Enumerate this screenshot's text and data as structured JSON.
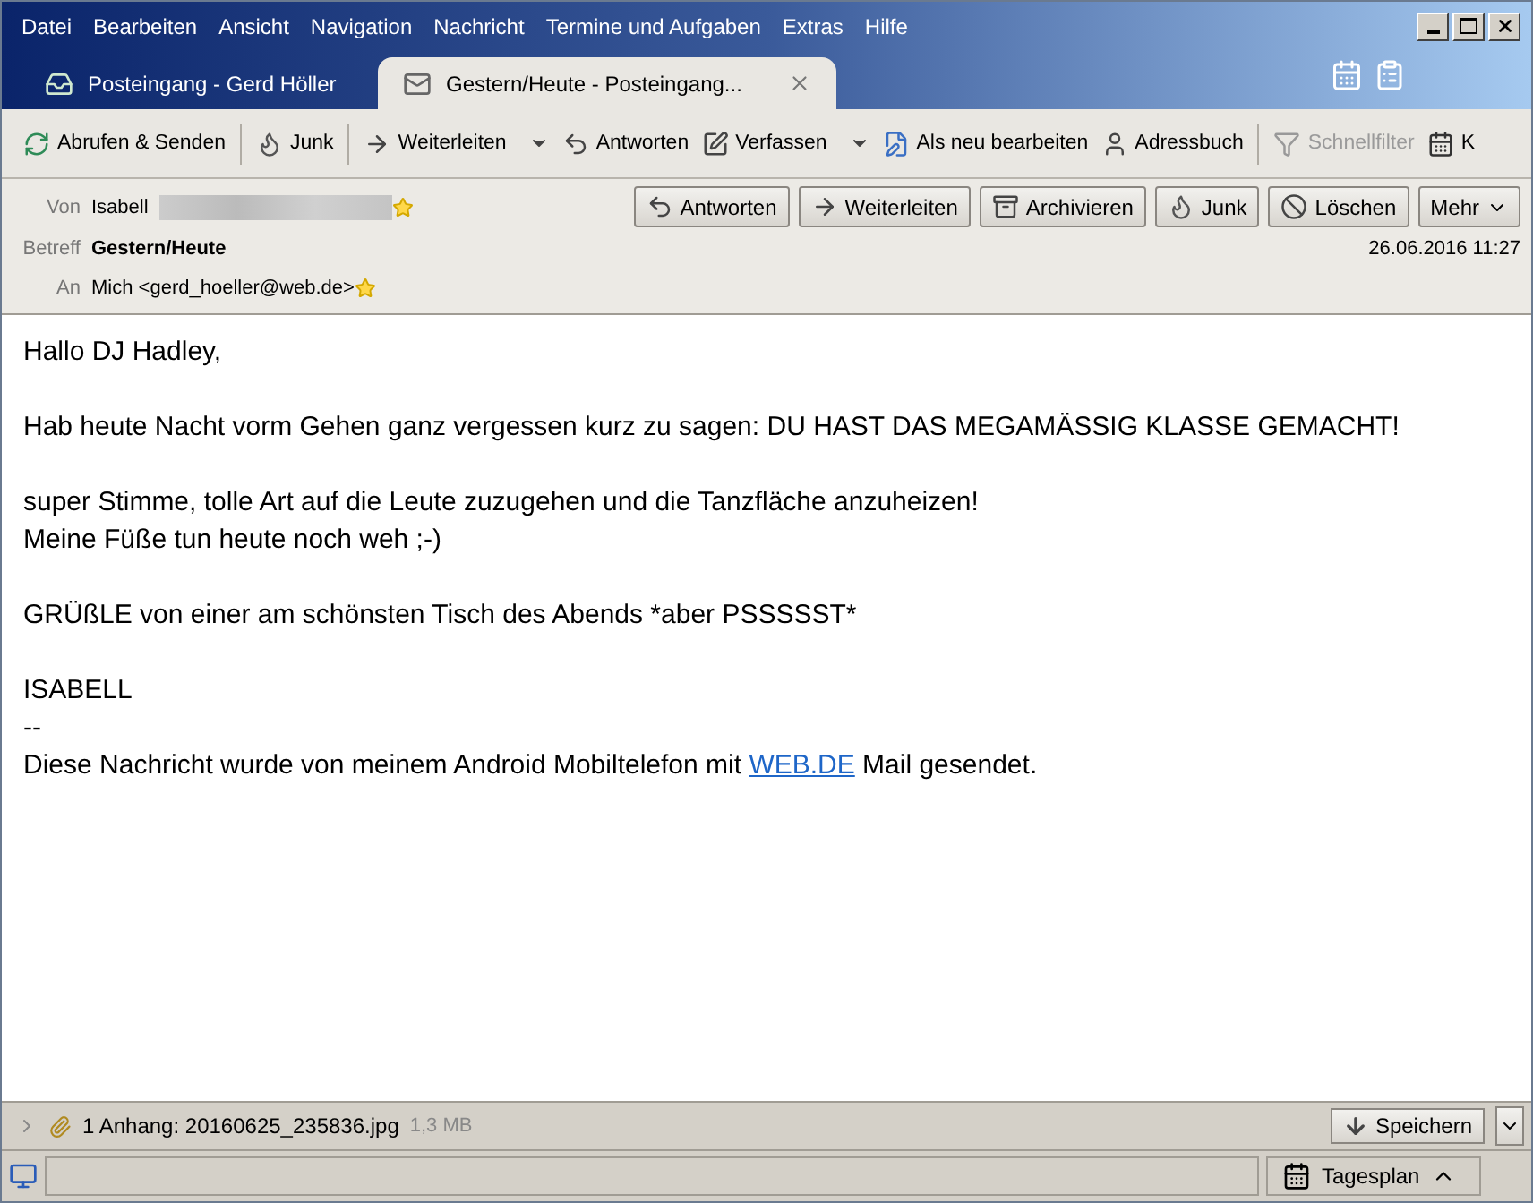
{
  "menu": [
    "Datei",
    "Bearbeiten",
    "Ansicht",
    "Navigation",
    "Nachricht",
    "Termine und Aufgaben",
    "Extras",
    "Hilfe"
  ],
  "tabs": [
    {
      "label": "Posteingang - Gerd Höller",
      "selected": false
    },
    {
      "label": "Gestern/Heute - Posteingang...",
      "selected": true,
      "closable": true
    }
  ],
  "toolbar": [
    [
      {
        "label": "Abrufen & Senden",
        "menu": false,
        "disabled": false
      }
    ],
    [
      {
        "label": "Junk",
        "menu": false,
        "disabled": false
      }
    ],
    [
      {
        "label": "Weiterleiten",
        "menu": true,
        "disabled": false
      },
      {
        "label": "Antworten",
        "menu": false,
        "disabled": false
      },
      {
        "label": "Verfassen",
        "menu": true,
        "disabled": false
      },
      {
        "label": "Als neu bearbeiten",
        "menu": false,
        "disabled": false
      },
      {
        "label": "Adressbuch",
        "menu": false,
        "disabled": false
      }
    ],
    [
      {
        "label": "Schnellfilter",
        "menu": false,
        "disabled": true
      },
      {
        "label": "K",
        "menu": false,
        "disabled": false
      }
    ]
  ],
  "header": {
    "from_label": "Von",
    "from": "Isabell",
    "subject_label": "Betreff",
    "subject": "Gestern/Heute",
    "to_label": "An",
    "to": "Mich <gerd_hoeller@web.de>",
    "date": "26.06.2016 11:27",
    "buttons": [
      "Antworten",
      "Weiterleiten",
      "Archivieren",
      "Junk",
      "Löschen",
      "Mehr"
    ]
  },
  "body": [
    [
      {
        "text": "Hallo DJ Hadley,"
      }
    ],
    [
      {
        "text": "Hab heute Nacht vorm Gehen ganz vergessen kurz zu sagen: DU HAST DAS MEGAMÄSSIG KLASSE GEMACHT!"
      }
    ],
    [
      {
        "text": "super Stimme, tolle Art auf die Leute zuzugehen und die Tanzfläche anzuheizen!"
      },
      {
        "text": "Meine Füße tun heute noch weh ;-)"
      }
    ],
    [
      {
        "text": "GRÜßLE von einer am schönsten Tisch des Abends *aber PSSSSST*"
      }
    ],
    [
      {
        "text": "ISABELL"
      },
      {
        "text": "--"
      },
      {
        "text": "Diese Nachricht wurde von meinem Android Mobiltelefon mit",
        "link": "WEB.DE",
        "after": "Mail gesendet."
      }
    ]
  ],
  "attachment": {
    "summary": "1 Anhang:",
    "file": "20160625_235836.jpg",
    "size": "1,3 MB",
    "save": "Speichern"
  },
  "status": {
    "today": "Tagesplan"
  }
}
